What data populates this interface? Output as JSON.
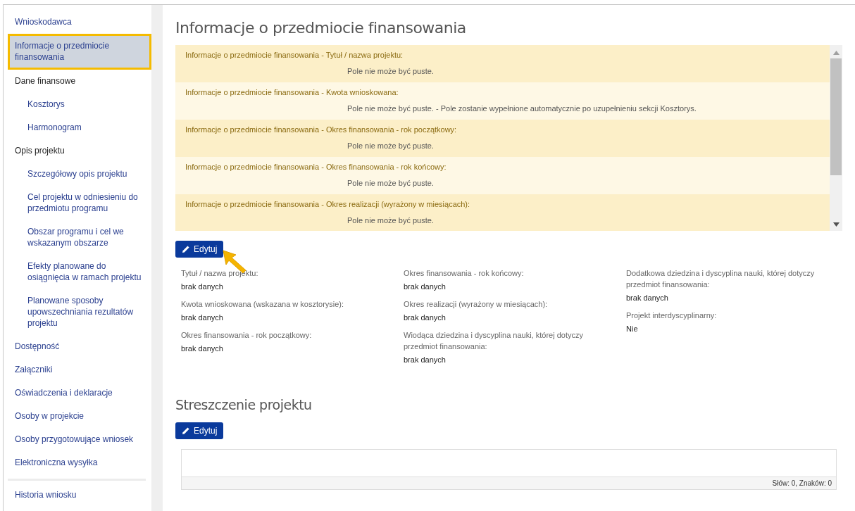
{
  "sidebar": {
    "items": [
      {
        "label": "Wnioskodawca",
        "selected": false
      },
      {
        "label": "Informacje o przedmiocie finansowania",
        "selected": true
      },
      {
        "label": "Dane finansowe",
        "selected": false,
        "children": [
          {
            "label": "Kosztorys",
            "selected": false
          },
          {
            "label": "Harmonogram",
            "selected": false
          }
        ]
      },
      {
        "label": "Opis projektu",
        "selected": false,
        "children": [
          {
            "label": "Szczegółowy opis projektu",
            "selected": false
          },
          {
            "label": "Cel projektu w odniesieniu do przedmiotu programu",
            "selected": false
          },
          {
            "label": "Obszar programu i cel we wskazanym obszarze",
            "selected": false
          },
          {
            "label": "Efekty planowane do osiągnięcia w ramach projektu",
            "selected": false
          },
          {
            "label": "Planowane sposoby upowszechniania rezultatów projektu",
            "selected": false
          }
        ]
      },
      {
        "label": "Dostępność",
        "selected": false
      },
      {
        "label": "Załączniki",
        "selected": false
      },
      {
        "label": "Oświadczenia i deklaracje",
        "selected": false
      },
      {
        "label": "Osoby w projekcie",
        "selected": false
      },
      {
        "label": "Osoby przygotowujące wniosek",
        "selected": false
      },
      {
        "label": "Elektroniczna wysyłka",
        "selected": false
      }
    ],
    "footer_items": [
      {
        "label": "Historia wniosku",
        "selected": false
      }
    ]
  },
  "section": {
    "title": "Informacje o przedmiocie finansowania",
    "validation_errors": [
      {
        "field": "Informacje o przedmiocie finansowania - Tytuł / nazwa projektu:",
        "message": "Pole nie może być puste."
      },
      {
        "field": "Informacje o przedmiocie finansowania - Kwota wnioskowana:",
        "message": "Pole nie może być puste. - Pole zostanie wypełnione automatycznie po uzupełnieniu sekcji Kosztorys."
      },
      {
        "field": "Informacje o przedmiocie finansowania - Okres finansowania - rok początkowy:",
        "message": "Pole nie może być puste."
      },
      {
        "field": "Informacje o przedmiocie finansowania - Okres finansowania - rok końcowy:",
        "message": "Pole nie może być puste."
      },
      {
        "field": "Informacje o przedmiocie finansowania - Okres realizacji (wyrażony w miesiącach):",
        "message": "Pole nie może być puste."
      }
    ],
    "edit_button": "Edytuj",
    "field_columns": [
      [
        {
          "label": "Tytuł / nazwa projektu:",
          "value": "brak danych"
        },
        {
          "label": "Kwota wnioskowana (wskazana w kosztorysie):",
          "value": "brak danych"
        },
        {
          "label": "Okres finansowania - rok początkowy:",
          "value": "brak danych"
        }
      ],
      [
        {
          "label": "Okres finansowania - rok końcowy:",
          "value": "brak danych"
        },
        {
          "label": "Okres realizacji (wyrażony w miesiącach):",
          "value": "brak danych"
        },
        {
          "label": "Wiodąca dziedzina i dyscyplina nauki, której dotyczy przedmiot finansowania:",
          "value": "brak danych"
        }
      ],
      [
        {
          "label": "Dodatkowa dziedzina i dyscyplina nauki, której dotyczy przedmiot finansowania:",
          "value": "brak danych"
        },
        {
          "label": "Projekt interdyscyplinarny:",
          "value": "Nie"
        }
      ]
    ]
  },
  "summary_section": {
    "title": "Streszczenie projektu",
    "edit_button": "Edytuj",
    "editor": {
      "counter": "Słów: 0, Znaków: 0"
    }
  }
}
